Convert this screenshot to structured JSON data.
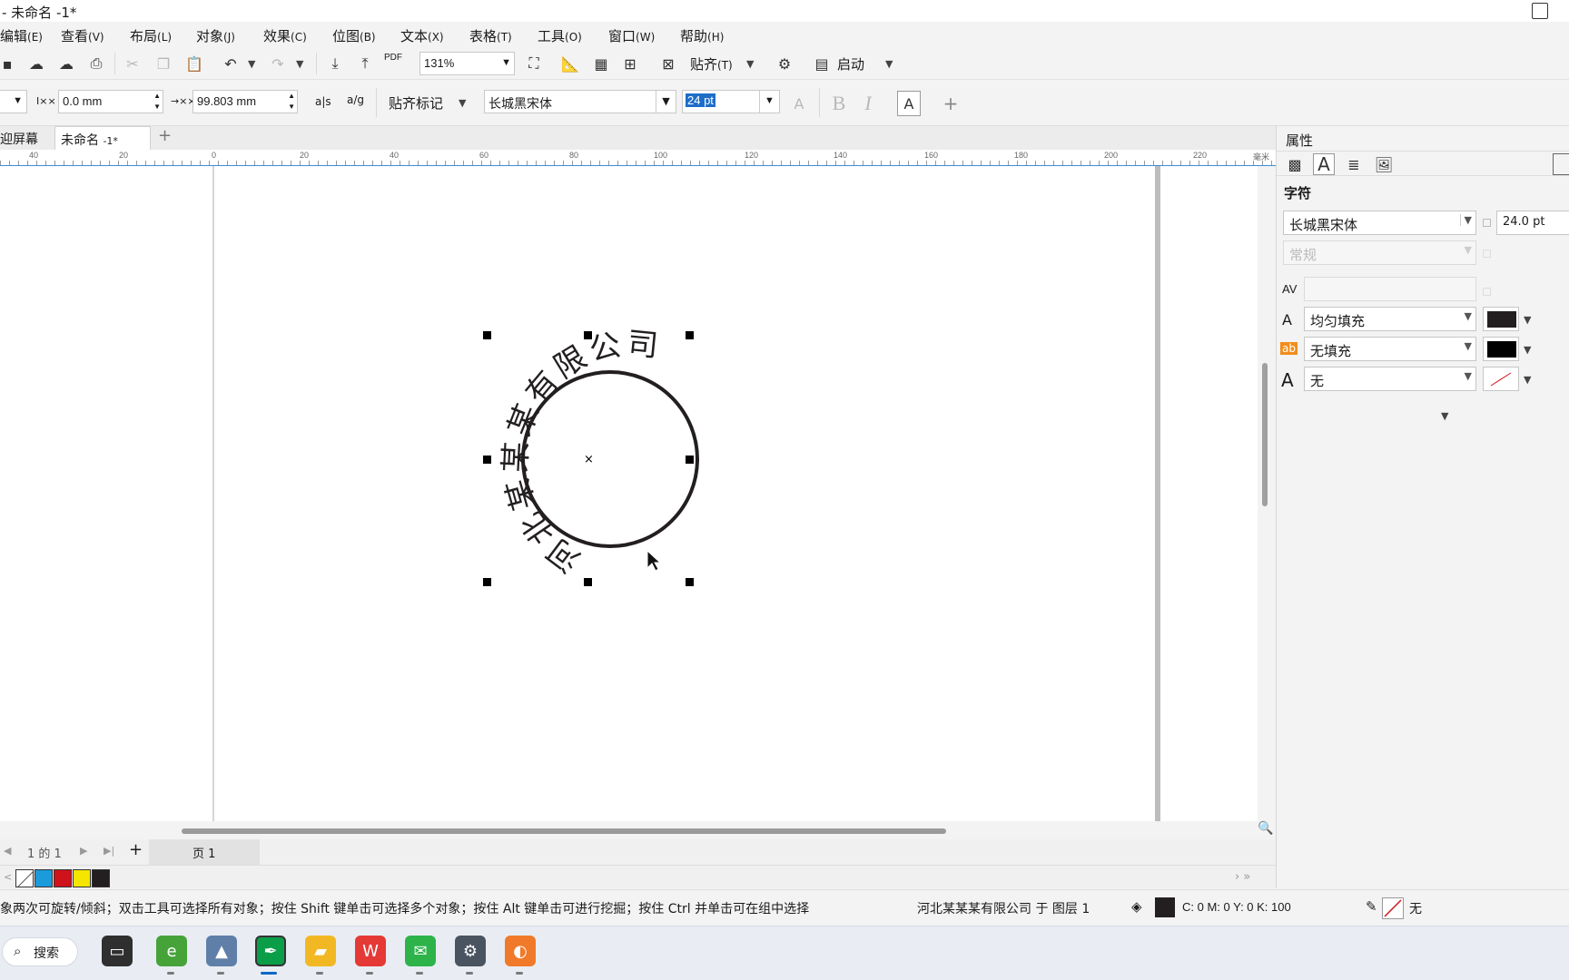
{
  "window": {
    "title": "- 未命名 -1*"
  },
  "menu": [
    {
      "label": "编辑",
      "acc": "(E)"
    },
    {
      "label": "查看",
      "acc": "(V)"
    },
    {
      "label": "布局",
      "acc": "(L)"
    },
    {
      "label": "对象",
      "acc": "(J)"
    },
    {
      "label": "效果",
      "acc": "(C)"
    },
    {
      "label": "位图",
      "acc": "(B)"
    },
    {
      "label": "文本",
      "acc": "(X)"
    },
    {
      "label": "表格",
      "acc": "(T)"
    },
    {
      "label": "工具",
      "acc": "(O)"
    },
    {
      "label": "窗口",
      "acc": "(W)"
    },
    {
      "label": "帮助",
      "acc": "(H)"
    }
  ],
  "toolbar1": {
    "zoom": "131%",
    "snap_label": "贴齐",
    "snap_acc": "(T)",
    "launch_label": "启动",
    "pdf_label": "PDF"
  },
  "toolbar2": {
    "offset_label": "I××",
    "offset_value": "0.0 mm",
    "distance_label": "→××",
    "distance_value": "99.803 mm",
    "snap_marks": "贴齐标记",
    "font_name": "长城黑宋体",
    "font_size": "24 pt",
    "bold": "B",
    "italic": "I",
    "mirror1": "a|s",
    "mirror2": "a/g"
  },
  "doc_tabs": {
    "welcome": "迎屏幕",
    "current": "未命名",
    "current_suffix": "-1*",
    "add": "+"
  },
  "ruler": {
    "ticks": [
      "40",
      "20",
      "0",
      "20",
      "40",
      "60",
      "80",
      "100",
      "120",
      "140",
      "160",
      "180",
      "200",
      "220"
    ],
    "unit": "毫米"
  },
  "canvas": {
    "circle_text": "河北某某某有限公司"
  },
  "pagebar": {
    "page_count": "1  的  1",
    "page_tab": "页 1",
    "add": "+"
  },
  "palette": {
    "colors": [
      "#1b9bdb",
      "#d0121b",
      "#f5e600",
      "#231f20"
    ]
  },
  "status": {
    "hint": "象两次可旋转/倾斜；双击工具可选择所有对象；按住 Shift 键单击可选择多个对象；按住 Alt 键单击可进行挖掘；按住 Ctrl 并单击可在组中选择",
    "object": "河北某某某有限公司 于 图层 1",
    "cmyk": "C:   0 M:   0 Y:   0 K:  100",
    "outline": "无"
  },
  "taskbar": {
    "search": "搜索"
  },
  "properties": {
    "title": "属性",
    "section": "字符",
    "font": "长城黑宋体",
    "size": "24.0 pt",
    "style": "常规",
    "kerning_label": "AV",
    "text_fill": "均匀填充",
    "text_fill_color": "#231f20",
    "bg_fill": "无填充",
    "bg_fill_color": "#000000",
    "outline": "无"
  }
}
